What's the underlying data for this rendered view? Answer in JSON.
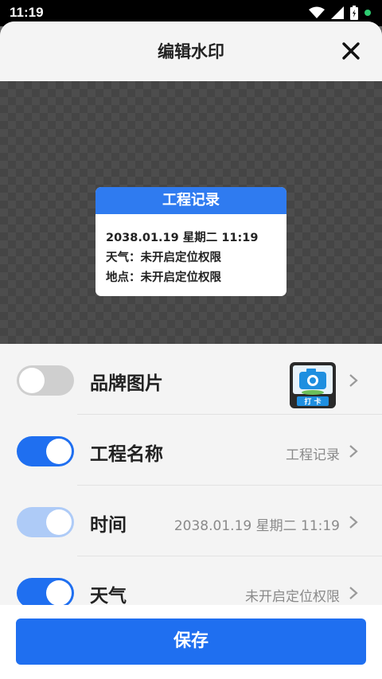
{
  "status_bar": {
    "time": "11:19"
  },
  "header": {
    "title": "编辑水印"
  },
  "watermark": {
    "title": "工程记录",
    "lines": [
      "2038.01.19 星期二 11:19",
      "天气：未开启定位权限",
      "地点：未开启定位权限"
    ]
  },
  "settings": [
    {
      "label": "品牌图片",
      "value": "",
      "toggle": "off",
      "brand_badge": "打 卡"
    },
    {
      "label": "工程名称",
      "value": "工程记录",
      "toggle": "on"
    },
    {
      "label": "时间",
      "value": "2038.01.19 星期二 11:19",
      "toggle": "on-dim"
    },
    {
      "label": "天气",
      "value": "未开启定位权限",
      "toggle": "on"
    }
  ],
  "footer": {
    "save_label": "保存"
  },
  "colors": {
    "accent": "#1f6ff0",
    "watermark_header": "#2f7bf0"
  }
}
